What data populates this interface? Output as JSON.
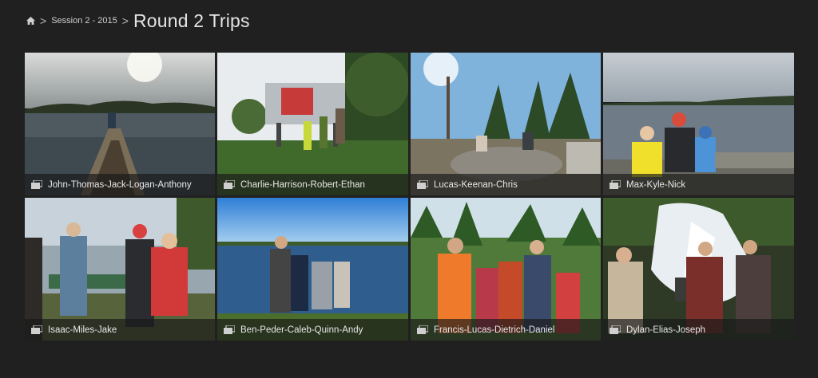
{
  "breadcrumb": {
    "home_icon": "home-icon",
    "parent": "Session 2 - 2015",
    "separator": ">"
  },
  "title": "Round 2 Trips",
  "albums": [
    {
      "label": "John-Thomas-Jack-Logan-Anthony",
      "icon": "album-icon"
    },
    {
      "label": "Charlie-Harrison-Robert-Ethan",
      "icon": "album-icon"
    },
    {
      "label": "Lucas-Keenan-Chris",
      "icon": "album-icon"
    },
    {
      "label": "Max-Kyle-Nick",
      "icon": "album-icon"
    },
    {
      "label": "Isaac-Miles-Jake",
      "icon": "album-icon"
    },
    {
      "label": "Ben-Peder-Caleb-Quinn-Andy",
      "icon": "album-icon"
    },
    {
      "label": "Francis-Lucas-Dietrich-Daniel",
      "icon": "album-icon"
    },
    {
      "label": "Dylan-Elias-Joseph",
      "icon": "album-icon"
    }
  ],
  "colors": {
    "background": "#202020",
    "caption_bar": "#191919",
    "text": "#e8e8e8"
  }
}
